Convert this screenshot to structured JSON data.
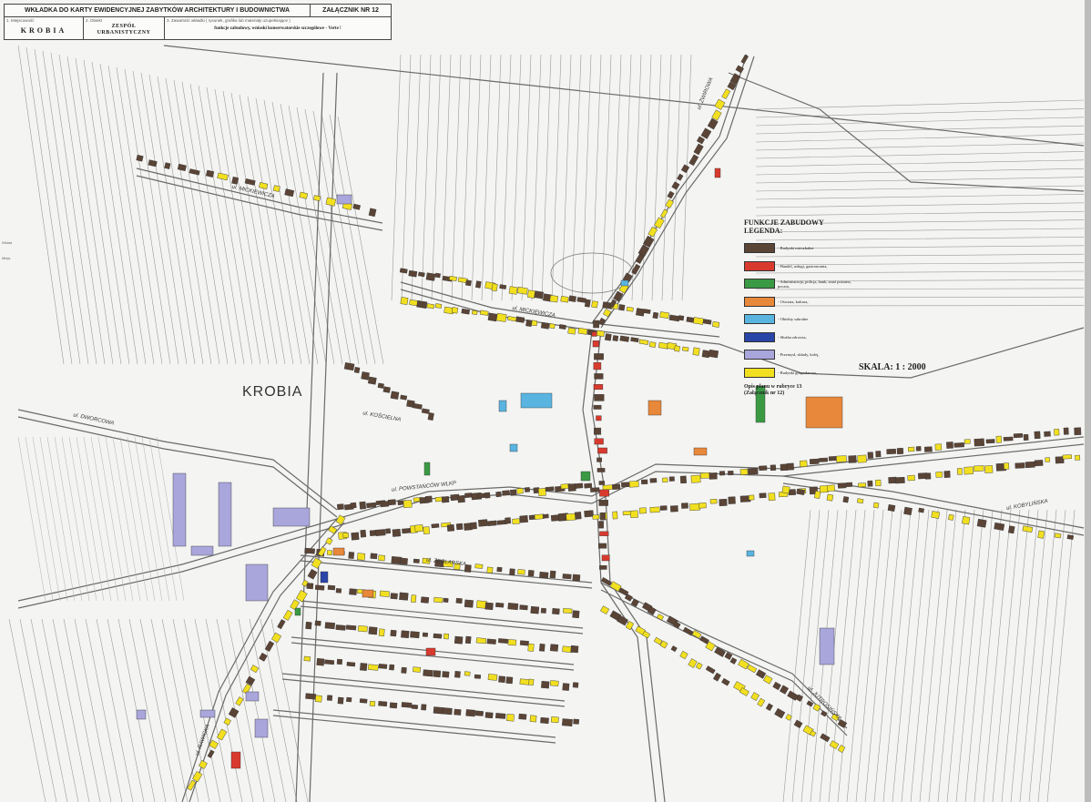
{
  "header": {
    "title": "WKŁADKA DO KARTY EWIDENCYJNEJ ZABYTKÓW ARCHITEKTURY I BUDOWNICTWA",
    "attachment": "ZAŁĄCZNIK NR 12",
    "field1_label": "1. Miejscowość",
    "field1_value": "KROBIA",
    "field2_label": "2. Obiekt",
    "field2_value_line1": "ZESPÓŁ",
    "field2_value_line2": "URBANISTYCZNY",
    "field3_label": "3. Zawartość wkładki ( rysunek, grafika lub materiały uzupełniające )",
    "field3_value": "funkcje zabudowy, wnioski konserwatorskie szczegółowe - Verte !"
  },
  "side_labels": [
    "Wkład",
    "Miejs"
  ],
  "map": {
    "town_label": "KROBIA",
    "streets": [
      {
        "id": "mickiewicza-w",
        "text": "ul. MICKIEWICZA"
      },
      {
        "id": "mickiewicza-c",
        "text": "ul. MICKIEWICZA"
      },
      {
        "id": "poniatowskiego",
        "text": "ul. POWSTAŃCÓW WLKP"
      },
      {
        "id": "kobylinska",
        "text": "ul. KOBYLIŃSKA"
      },
      {
        "id": "zwirowa",
        "text": "ul. ŻWIROWA"
      },
      {
        "id": "dworcowa",
        "text": "ul. DWORCOWA"
      },
      {
        "id": "zeglarska",
        "text": "ul. ZEGLARSKA"
      },
      {
        "id": "jutrosinska",
        "text": "ul. JUTROSIŃSKA"
      },
      {
        "id": "koscielna",
        "text": "ul. KOŚCIELNA"
      },
      {
        "id": "rawicka",
        "text": "ul. RAWICKA"
      }
    ]
  },
  "legend": {
    "title_line1": "FUNKCJE ZABUDOWY",
    "title_line2": "LEGENDA:",
    "items": [
      {
        "color": "#5a4436",
        "label": "- Budynki mieszkalne"
      },
      {
        "color": "#d93a2e",
        "label": "- Handel, usługi, gastronomia,"
      },
      {
        "color": "#3a9a44",
        "label": "- Administracja, policja, bank, straż pożarna, poczta,"
      },
      {
        "color": "#e8883a",
        "label": "- Oświata, kultura,"
      },
      {
        "color": "#5ab4e0",
        "label": "- Obiekty sakralne"
      },
      {
        "color": "#2a45a8",
        "label": "- Służba zdrowia,"
      },
      {
        "color": "#a9a6dc",
        "label": "- Przemysł, składy, kolej,"
      },
      {
        "color": "#f2e020",
        "label": "- Budynki gospodarcze,"
      }
    ],
    "note_line1": "Opis planu w rubryce 13",
    "note_line2": "(Załącznik nr 12)"
  },
  "scale": "SKALA: 1 : 2000",
  "colors": {
    "residential": "#5a4436",
    "commerce": "#d93a2e",
    "administration": "#3a9a44",
    "education": "#e8883a",
    "sacral": "#5ab4e0",
    "health": "#2a45a8",
    "industry": "#a9a6dc",
    "utility": "#f2e020"
  }
}
